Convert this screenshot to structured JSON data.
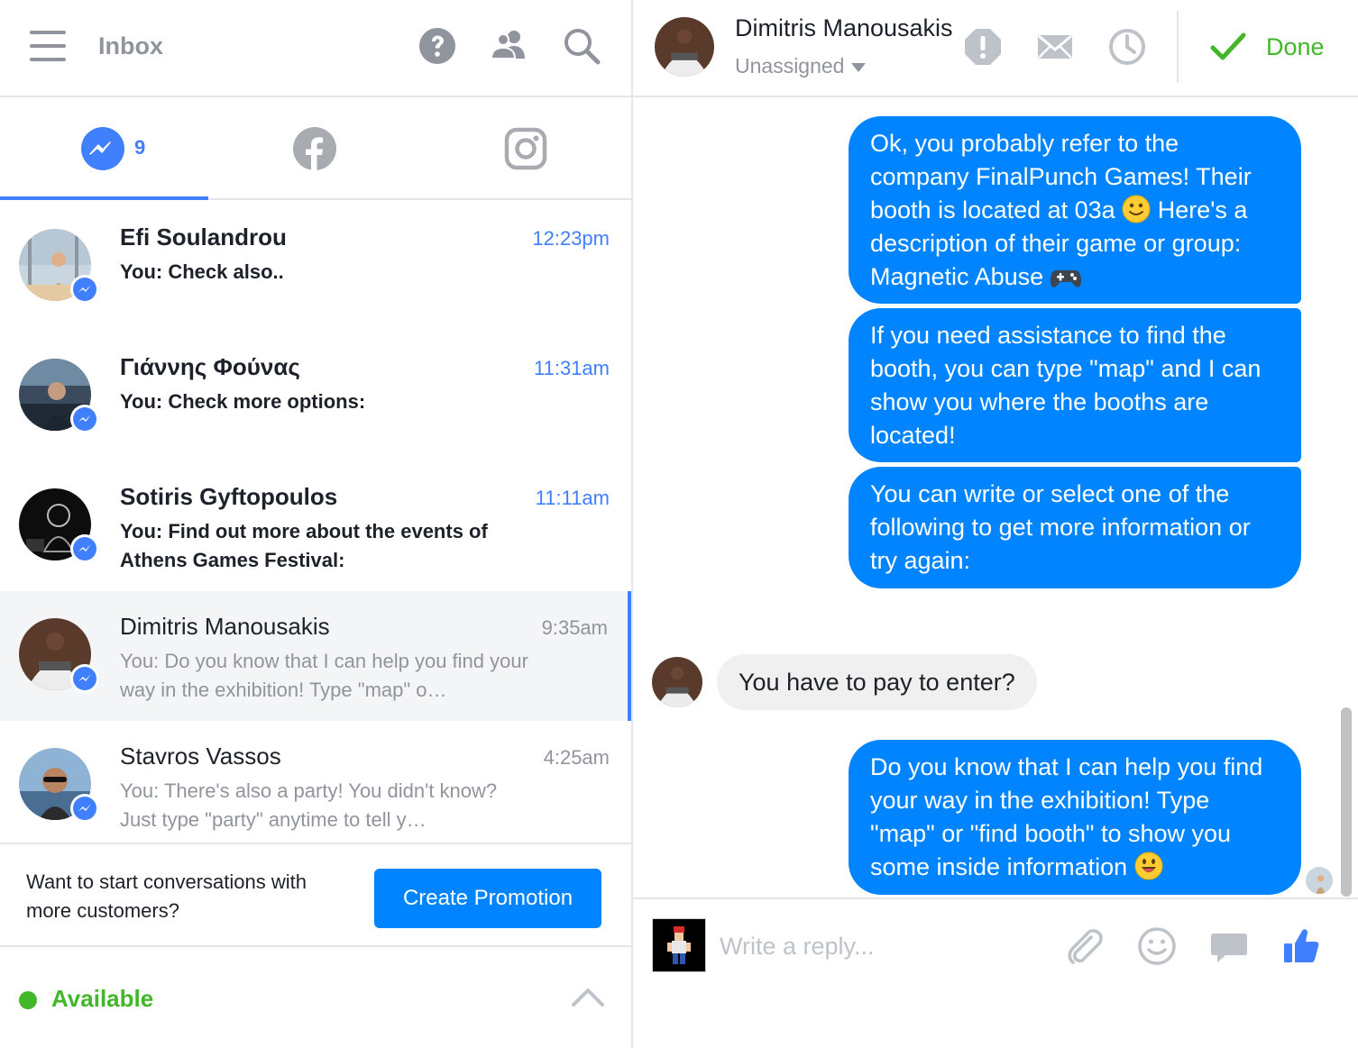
{
  "inbox": {
    "title": "Inbox",
    "header_icons": [
      "help-icon",
      "people-icon",
      "search-icon"
    ]
  },
  "channel_tabs": {
    "messenger_count": "9",
    "tabs": [
      "messenger",
      "facebook",
      "instagram"
    ],
    "active": "messenger"
  },
  "conversations": [
    {
      "name": "Efi Soulandrou",
      "time": "12:23pm",
      "preview": "You: Check also..",
      "unread": true
    },
    {
      "name": "Γιάννης Φούνας",
      "time": "11:31am",
      "preview": "You: Check more options:",
      "unread": true
    },
    {
      "name": "Sotiris Gyftopoulos",
      "time": "11:11am",
      "preview": "You: Find out more about the events of Athens Games Festival:",
      "unread": true
    },
    {
      "name": "Dimitris Manousakis",
      "time": "9:35am",
      "preview": "You: Do you know that I can help you find your way in the exhibition! Type \"map\" o…",
      "unread": false,
      "selected": true
    },
    {
      "name": "Stavros Vassos",
      "time": "4:25am",
      "preview": "You: There's also a party! You didn't know? Just type \"party\" anytime to tell y…",
      "unread": false
    }
  ],
  "promo": {
    "text": "Want to start conversations with more customers?",
    "button": "Create Promotion"
  },
  "status": {
    "label": "Available",
    "color": "#42b72a"
  },
  "contact": {
    "name": "Dimitris Manousakis",
    "assignment": "Unassigned"
  },
  "actions": {
    "done_label": "Done"
  },
  "messages": {
    "m1": {
      "before": "Ok, you probably refer to the company FinalPunch Games! Their booth is located at 03a ",
      "after": " Here's a description of their game or group: Magnetic Abuse "
    },
    "m2": "If you need assistance to find the booth, you can type \"map\" and I can show you where the booths are located!",
    "m3": "You can write or select one of the following to get more information or try again:",
    "incoming": "You have to pay to enter?",
    "m4": "Do you know that I can help you find your way in the exhibition! Type \"map\" or \"find booth\" to show you some inside information "
  },
  "composer": {
    "placeholder": "Write a reply..."
  },
  "colors": {
    "accent": "#4080ff",
    "outgoing_bubble": "#0084ff",
    "incoming_bubble": "#f1f0f0",
    "muted": "#90949c",
    "success": "#42b72a"
  }
}
